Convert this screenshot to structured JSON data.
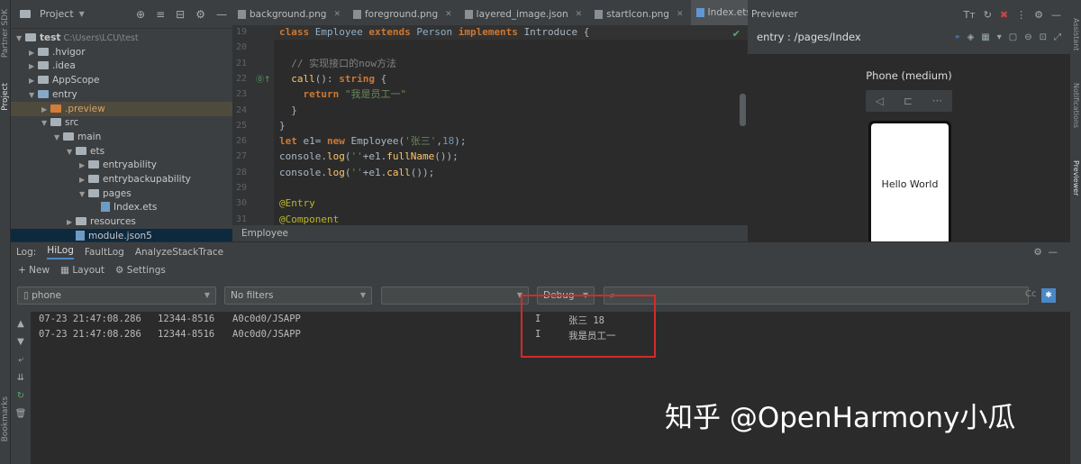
{
  "left_strip": {
    "labels": [
      "Partner SDK",
      "Project",
      "Bookmarks"
    ]
  },
  "right_strip": {
    "labels": [
      "Assistant",
      "Notifications",
      "Previewer"
    ]
  },
  "project_panel": {
    "title": "Project",
    "items": [
      {
        "label": "test",
        "path": "C:\\Users\\LCU\\test",
        "depth": 0,
        "open": true,
        "icon": "folder"
      },
      {
        "label": ".hvigor",
        "depth": 1,
        "open": false,
        "icon": "folder"
      },
      {
        "label": ".idea",
        "depth": 1,
        "open": false,
        "icon": "folder"
      },
      {
        "label": "AppScope",
        "depth": 1,
        "open": false,
        "icon": "folder"
      },
      {
        "label": "entry",
        "depth": 1,
        "open": true,
        "icon": "folder-blue"
      },
      {
        "label": ".preview",
        "depth": 2,
        "open": false,
        "icon": "folder-orange"
      },
      {
        "label": "src",
        "depth": 2,
        "open": true,
        "icon": "folder"
      },
      {
        "label": "main",
        "depth": 3,
        "open": true,
        "icon": "folder"
      },
      {
        "label": "ets",
        "depth": 4,
        "open": true,
        "icon": "folder"
      },
      {
        "label": "entryability",
        "depth": 5,
        "open": false,
        "icon": "folder"
      },
      {
        "label": "entrybackupability",
        "depth": 5,
        "open": false,
        "icon": "folder"
      },
      {
        "label": "pages",
        "depth": 5,
        "open": true,
        "icon": "folder"
      },
      {
        "label": "Index.ets",
        "depth": 6,
        "icon": "file"
      },
      {
        "label": "resources",
        "depth": 4,
        "open": false,
        "icon": "folder"
      },
      {
        "label": "module.json5",
        "depth": 4,
        "icon": "file"
      }
    ]
  },
  "editor_tabs": [
    {
      "label": "background.png",
      "active": false
    },
    {
      "label": "foreground.png",
      "active": false
    },
    {
      "label": "layered_image.json",
      "active": false
    },
    {
      "label": "startIcon.png",
      "active": false
    },
    {
      "label": "Index.ets",
      "active": true
    }
  ],
  "editor": {
    "lines": [
      {
        "n": "19",
        "tokens": [
          [
            "kw",
            "class "
          ],
          [
            "cls",
            "Employee "
          ],
          [
            "kw",
            "extends "
          ],
          [
            "cls",
            "Person "
          ],
          [
            "kw",
            "implements "
          ],
          [
            "t",
            "Introduce {"
          ]
        ]
      },
      {
        "n": "20",
        "tokens": []
      },
      {
        "n": "21",
        "tokens": [
          [
            "cmt",
            "  // 实现接口的now方法"
          ]
        ]
      },
      {
        "n": "22",
        "tokens": [
          [
            "fn",
            "  call"
          ],
          [
            "t",
            "(): "
          ],
          [
            "kw",
            "string "
          ],
          [
            "t",
            "{"
          ]
        ]
      },
      {
        "n": "23",
        "tokens": [
          [
            "kw",
            "    return "
          ],
          [
            "str",
            "\"我是员工一\""
          ]
        ]
      },
      {
        "n": "24",
        "tokens": [
          [
            "t",
            "  }"
          ]
        ]
      },
      {
        "n": "25",
        "tokens": [
          [
            "t",
            "}"
          ]
        ]
      },
      {
        "n": "26",
        "tokens": [
          [
            "kw",
            "let "
          ],
          [
            "t",
            "e1= "
          ],
          [
            "kw",
            "new "
          ],
          [
            "t",
            "Employee("
          ],
          [
            "str",
            "'张三'"
          ],
          [
            "t",
            ","
          ],
          [
            "num",
            "18"
          ],
          [
            "t",
            ");"
          ]
        ]
      },
      {
        "n": "27",
        "tokens": [
          [
            "t",
            "console."
          ],
          [
            "meth",
            "log"
          ],
          [
            "t",
            "("
          ],
          [
            "str",
            "''"
          ],
          [
            "t",
            "+e1."
          ],
          [
            "meth",
            "fullName"
          ],
          [
            "t",
            "());"
          ]
        ]
      },
      {
        "n": "28",
        "tokens": [
          [
            "t",
            "console."
          ],
          [
            "meth",
            "log"
          ],
          [
            "t",
            "("
          ],
          [
            "str",
            "''"
          ],
          [
            "t",
            "+e1."
          ],
          [
            "meth",
            "call"
          ],
          [
            "t",
            "());"
          ]
        ]
      },
      {
        "n": "29",
        "tokens": []
      },
      {
        "n": "30",
        "tokens": [
          [
            "ann",
            "@Entry"
          ]
        ]
      },
      {
        "n": "31",
        "tokens": [
          [
            "ann",
            "@Component"
          ]
        ]
      }
    ],
    "breadcrumb": "Employee"
  },
  "previewer": {
    "title": "Previewer",
    "route": "entry : /pages/Index",
    "device": "Phone (medium)",
    "screen_text": "Hello World"
  },
  "log_panel": {
    "label": "Log:",
    "tabs": [
      {
        "label": "HiLog",
        "active": true
      },
      {
        "label": "FaultLog",
        "active": false
      },
      {
        "label": "AnalyzeStackTrace",
        "active": false
      }
    ],
    "toolbar": {
      "new_label": "New",
      "layout_label": "Layout",
      "settings_label": "Settings"
    },
    "device_select": "phone",
    "filter_select": "No filters",
    "process_select": "",
    "level_select": "Debug",
    "search_placeholder": "",
    "match_case": "Cc",
    "entries": [
      {
        "time": "07-23 21:47:08.286",
        "pid": "12344-8516",
        "tag": "A0c0d0/JSAPP",
        "level": "I",
        "message": "张三 18"
      },
      {
        "time": "07-23 21:47:08.286",
        "pid": "12344-8516",
        "tag": "A0c0d0/JSAPP",
        "level": "I",
        "message": "我是员工一"
      }
    ]
  },
  "watermark": "知乎 @OpenHarmony小瓜"
}
